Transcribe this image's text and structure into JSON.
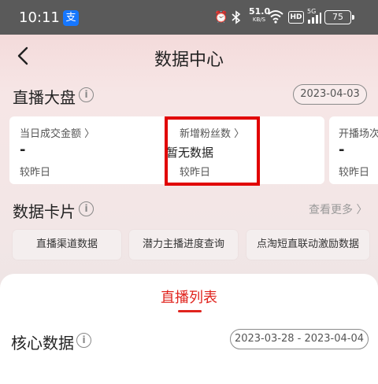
{
  "status_bar": {
    "time": "10:11",
    "app_badge": "支",
    "net_speed": "51.0",
    "net_unit": "KB/S",
    "hd": "HD",
    "signal_5g": "5G",
    "battery": "75"
  },
  "header": {
    "title": "数据中心"
  },
  "live_overview": {
    "title": "直播大盘",
    "date": "2023-04-03",
    "metrics": [
      {
        "label": "当日成交金额 〉",
        "value": "-",
        "sub": "较昨日"
      },
      {
        "label": "新增粉丝数 〉",
        "value": "暂无数据",
        "sub": "较昨日"
      },
      {
        "label": "开播场次",
        "value": "-",
        "sub": "较昨日"
      }
    ]
  },
  "data_cards": {
    "title": "数据卡片",
    "more_label": "查看更多",
    "buttons": [
      "直播渠道数据",
      "潜力主播进度查询",
      "点淘短直联动激励数据"
    ]
  },
  "live_list": {
    "tab_label": "直播列表",
    "core_title": "核心数据",
    "date_range": "2023-03-28 - 2023-04-04"
  },
  "colors": {
    "accent": "#e0241e",
    "highlight_box": "#e10000"
  }
}
